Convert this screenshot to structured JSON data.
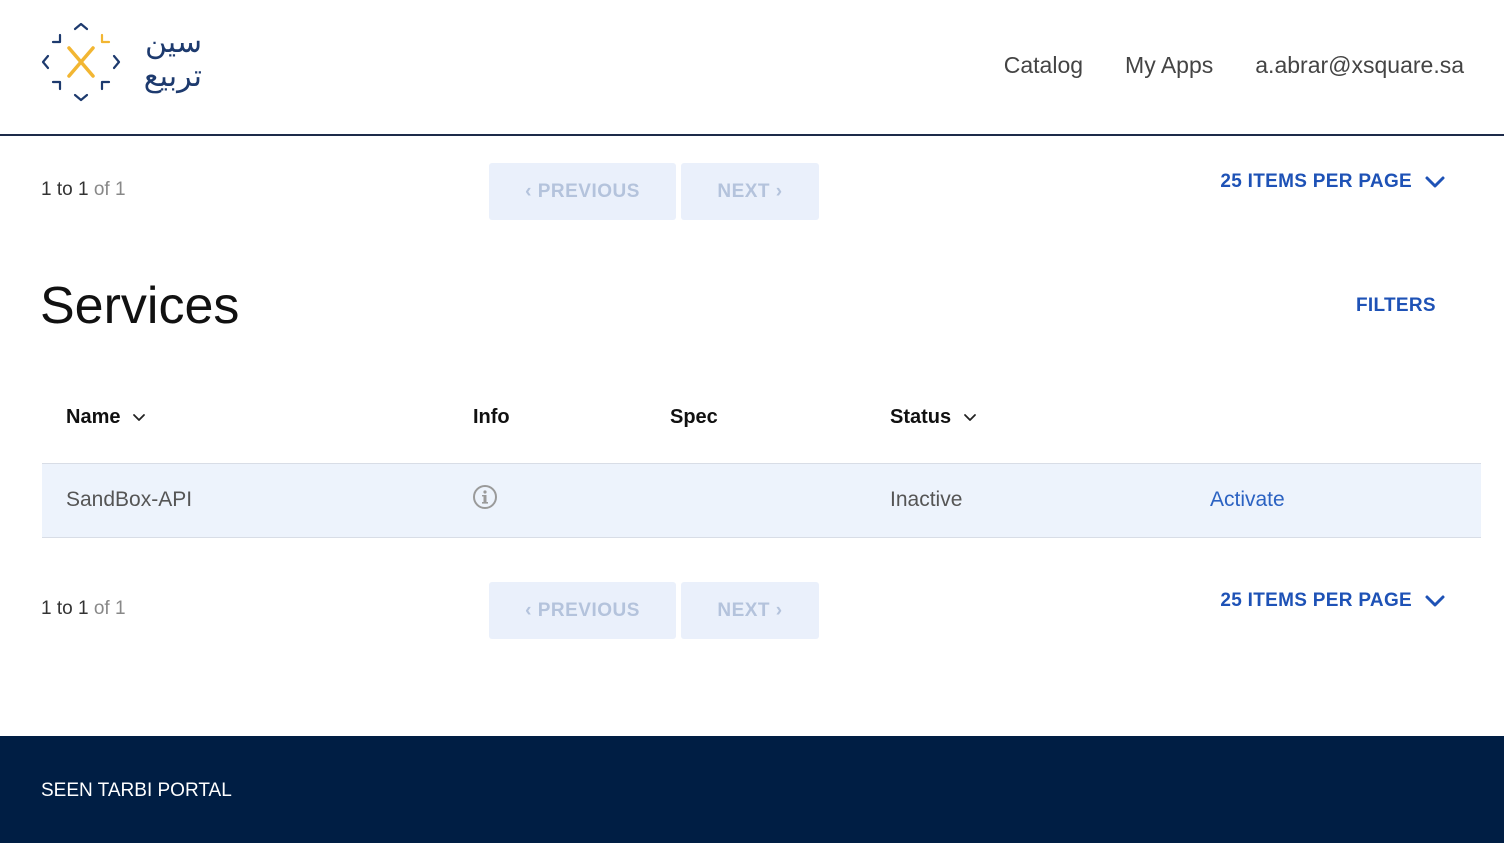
{
  "logo": {
    "arabic_line1": "سين",
    "arabic_line2": "تربيع",
    "accent": "#f2b632",
    "brand": "#1d3a6e"
  },
  "nav": {
    "items": [
      "Catalog",
      "My Apps",
      "a.abrar@xsquare.sa"
    ]
  },
  "pager": {
    "range_start": "1",
    "to_word": " to ",
    "range_end": "1",
    "of_text": " of 1",
    "previous_label": "‹ PREVIOUS",
    "next_label": "NEXT ›",
    "per_page_label": "25 ITEMS PER PAGE"
  },
  "page": {
    "title": "Services",
    "filters_label": "FILTERS"
  },
  "table": {
    "headers": {
      "name": "Name",
      "info": "Info",
      "spec": "Spec",
      "status": "Status"
    },
    "rows": [
      {
        "name": "SandBox-API",
        "spec": "",
        "status": "Inactive",
        "action": "Activate"
      }
    ]
  },
  "footer": {
    "text": "SEEN TARBI PORTAL"
  },
  "colors": {
    "accent": "#1e52b6",
    "footer_bg": "#001e44",
    "row_bg": "#edf3fc"
  }
}
